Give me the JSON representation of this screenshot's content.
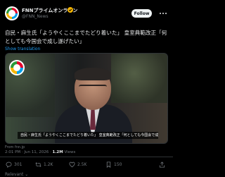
{
  "header": {
    "name": "FNNプライムオンライン",
    "handle": "@FNN_News",
    "follow_label": "Follow"
  },
  "tweet": {
    "text": "自民・麻生氏「ようやくここまでたどり着いた」 皇室典範改正「何としても今国会で成し遂げたい」",
    "translate_label": "Show translation"
  },
  "media": {
    "caption": "自民・麻生氏「ようやくここまでたどり着いた」  皇室典範改正「何としても今国会で成し遂げたい」",
    "source": "From fnn.jp"
  },
  "meta": {
    "time": "2:01 PM · Jun 11, 2026",
    "views_count": "1.2M",
    "views_label": "Views"
  },
  "actions": {
    "replies": "301",
    "reposts": "1.2K",
    "likes": "2.5K",
    "bookmarks": "150"
  },
  "footer": {
    "relevant_label": "Relevant"
  },
  "colors": {
    "background": "#000000",
    "text": "#e7e9ea",
    "muted": "#71767b",
    "accent": "#1d9bf0",
    "verified": "#f4b400"
  }
}
